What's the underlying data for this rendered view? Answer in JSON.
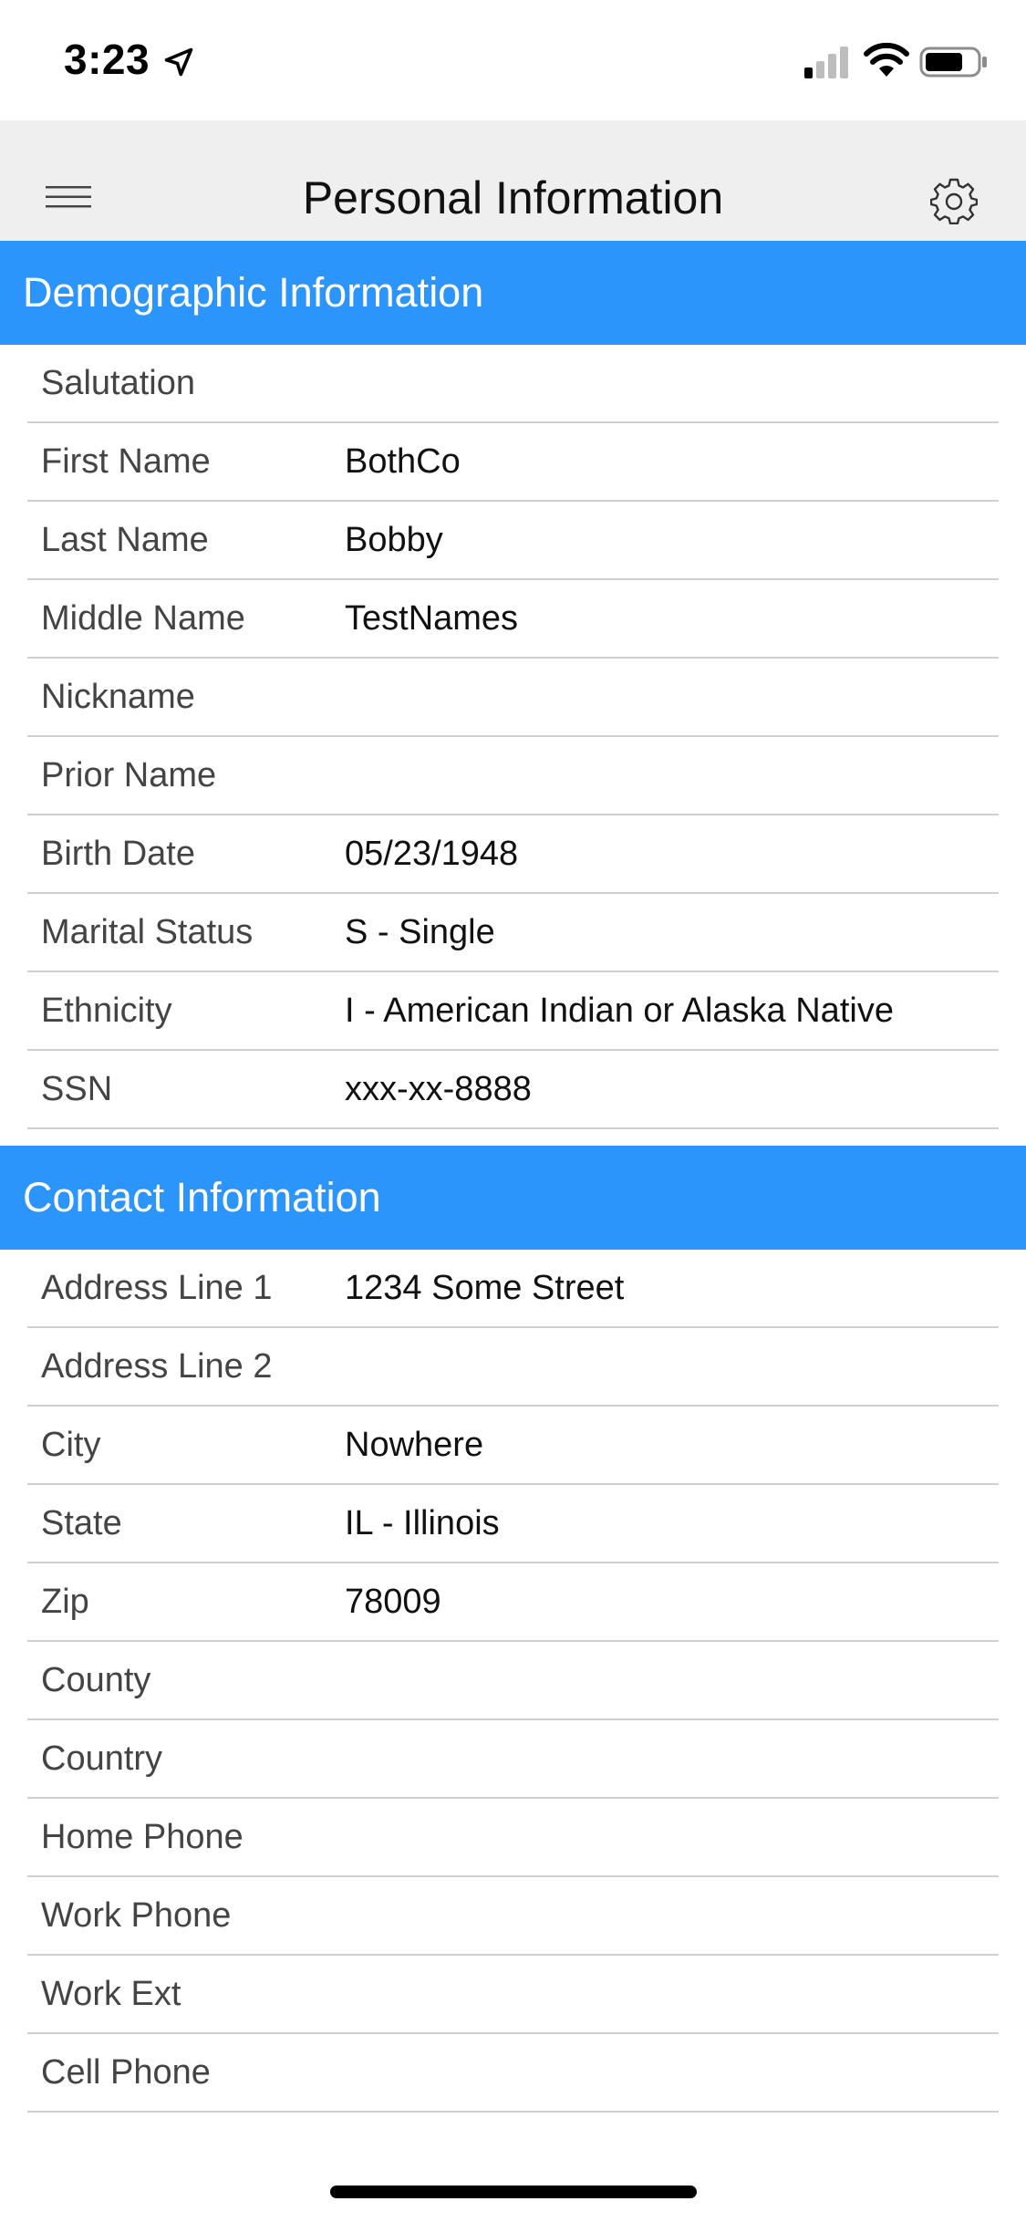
{
  "status_bar": {
    "time": "3:23"
  },
  "header": {
    "title": "Personal Information"
  },
  "sections": {
    "demographic": {
      "title": "Demographic Information",
      "rows": [
        {
          "label": "Salutation",
          "value": ""
        },
        {
          "label": "First Name",
          "value": "BothCo"
        },
        {
          "label": "Last Name",
          "value": "Bobby"
        },
        {
          "label": "Middle Name",
          "value": "TestNames"
        },
        {
          "label": "Nickname",
          "value": ""
        },
        {
          "label": "Prior Name",
          "value": ""
        },
        {
          "label": "Birth Date",
          "value": "05/23/1948"
        },
        {
          "label": "Marital Status",
          "value": "S - Single"
        },
        {
          "label": "Ethnicity",
          "value": "I - American Indian or Alaska Native"
        },
        {
          "label": "SSN",
          "value": "xxx-xx-8888"
        }
      ]
    },
    "contact": {
      "title": "Contact Information",
      "rows": [
        {
          "label": "Address Line 1",
          "value": "1234 Some Street"
        },
        {
          "label": "Address Line 2",
          "value": ""
        },
        {
          "label": "City",
          "value": "Nowhere"
        },
        {
          "label": "State",
          "value": "IL - Illinois"
        },
        {
          "label": "Zip",
          "value": "78009"
        },
        {
          "label": "County",
          "value": ""
        },
        {
          "label": "Country",
          "value": ""
        },
        {
          "label": "Home Phone",
          "value": ""
        },
        {
          "label": "Work Phone",
          "value": ""
        },
        {
          "label": "Work Ext",
          "value": ""
        },
        {
          "label": "Cell Phone",
          "value": ""
        }
      ]
    }
  },
  "colors": {
    "section_header": "#2b95fb",
    "header_bg": "#efefef",
    "divider": "#cfcfcf"
  },
  "icons": {
    "menu": "hamburger-menu-icon",
    "settings": "gear-icon",
    "location": "location-arrow-icon",
    "signal": "cellular-signal-icon",
    "wifi": "wifi-icon",
    "battery": "battery-icon"
  }
}
